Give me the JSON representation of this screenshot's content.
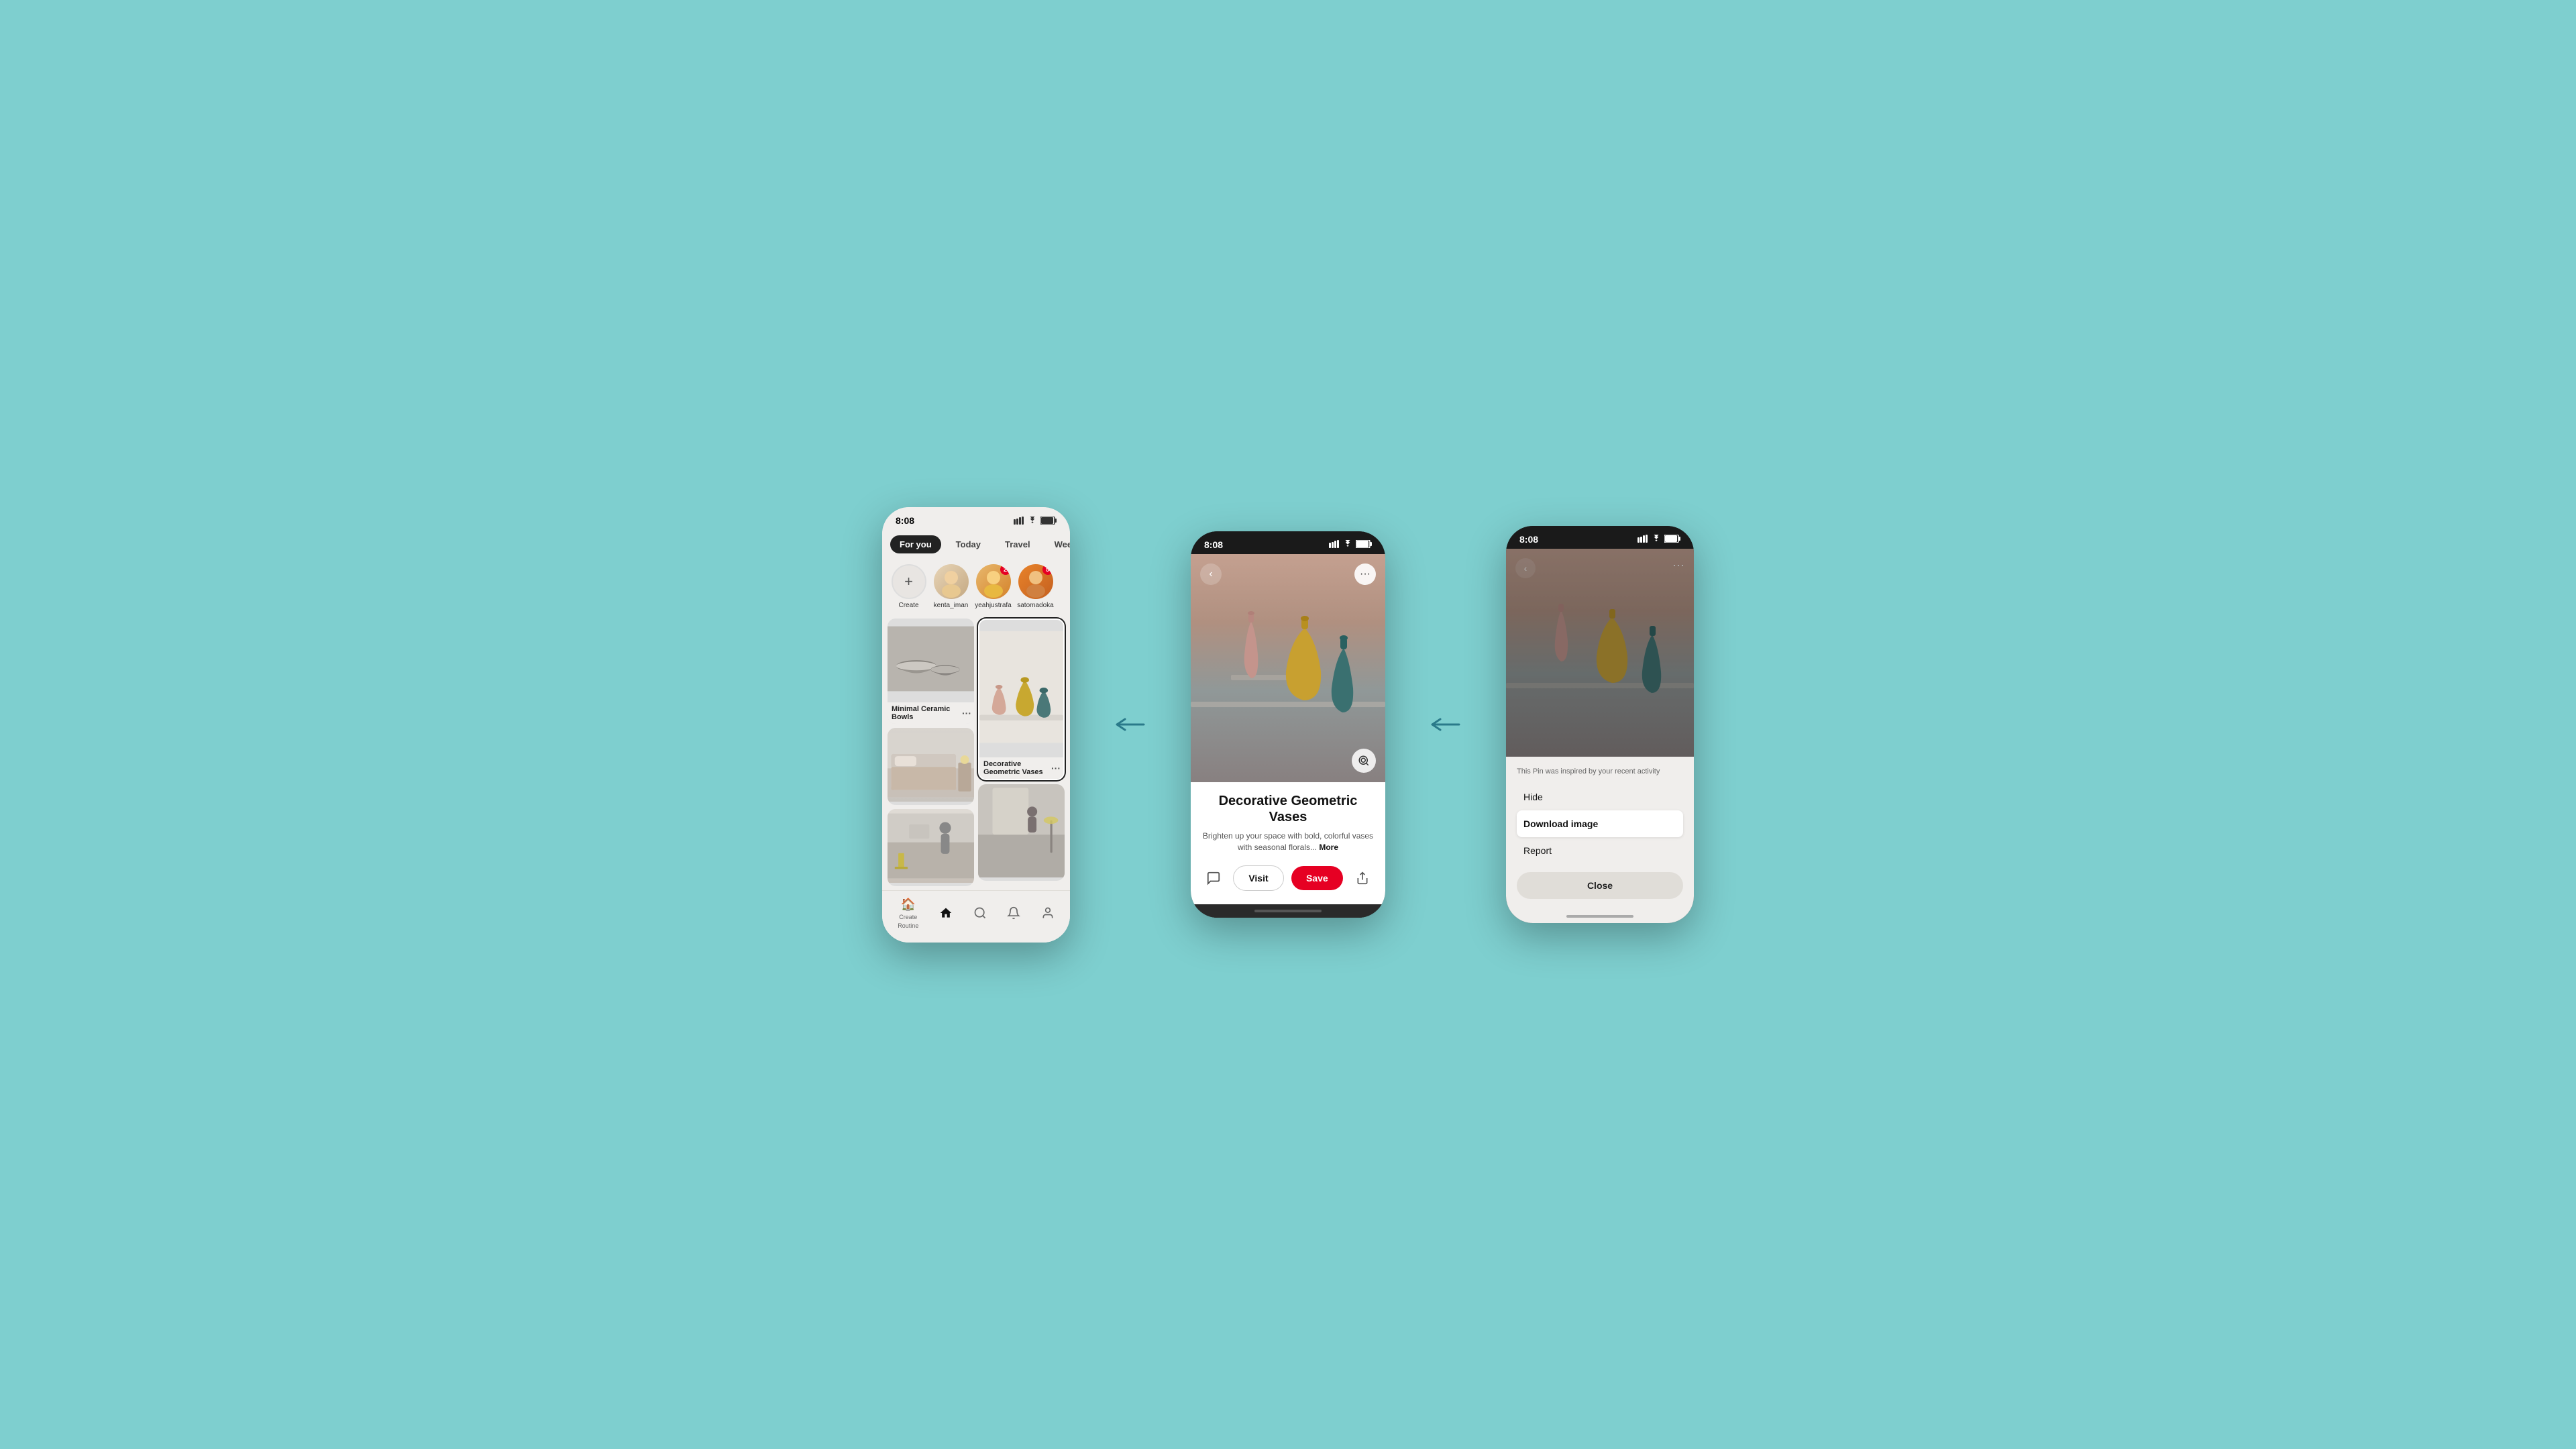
{
  "app": {
    "background_color": "#7ecfcf"
  },
  "phone1": {
    "status_time": "8:08",
    "tabs": [
      {
        "label": "For you",
        "active": true
      },
      {
        "label": "Today",
        "active": false
      },
      {
        "label": "Travel",
        "active": false
      },
      {
        "label": "Weekend trip",
        "active": false
      }
    ],
    "stories": [
      {
        "name": "Create",
        "type": "create"
      },
      {
        "name": "kenta_iman",
        "type": "avatar1",
        "badge": null
      },
      {
        "name": "yeahjustrafa",
        "type": "avatar2",
        "badge": "2"
      },
      {
        "name": "satomadoka",
        "type": "avatar3",
        "badge": "5"
      }
    ],
    "pins": {
      "left_col": [
        {
          "id": "bowls",
          "label": "Minimal Ceramic Bowls",
          "dots": "•••"
        },
        {
          "id": "room1",
          "label": ""
        },
        {
          "id": "room2",
          "label": ""
        }
      ],
      "right_col": [
        {
          "id": "vases",
          "label": "Decorative Geometric Vases",
          "dots": "•••",
          "highlighted": true
        },
        {
          "id": "interior",
          "label": ""
        }
      ]
    },
    "bottom_nav": [
      {
        "label": "Create Routine",
        "icon": "🏠"
      },
      {
        "label": "",
        "icon": "🏠"
      },
      {
        "label": "",
        "icon": "🔍"
      },
      {
        "label": "",
        "icon": "🔔"
      },
      {
        "label": "",
        "icon": "👤"
      }
    ]
  },
  "phone2": {
    "status_time": "8:08",
    "pin_title": "Decorative Geometric Vases",
    "pin_desc": "Brighten up your space with bold, colorful vases with seasonal florals...",
    "more_label": "More",
    "buttons": {
      "visit": "Visit",
      "save": "Save"
    }
  },
  "phone3": {
    "status_time": "8:08",
    "inspired_text": "This Pin was inspired by your recent activity",
    "menu_items": [
      {
        "label": "Hide",
        "highlighted": false
      },
      {
        "label": "Download image",
        "highlighted": true
      },
      {
        "label": "Report",
        "highlighted": false
      }
    ],
    "close_label": "Close"
  },
  "arrows": {
    "arrow1_label": "←",
    "arrow2_label": "←",
    "arrow3_label": "→"
  }
}
